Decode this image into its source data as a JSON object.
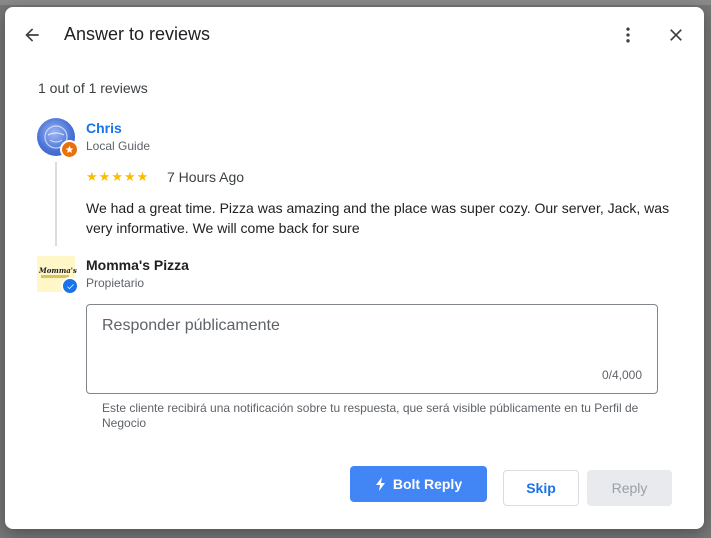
{
  "header": {
    "title": "Answer to reviews"
  },
  "review_count": "1 out of 1 reviews",
  "review": {
    "author": "Chris",
    "author_subtitle": "Local Guide",
    "rating": 5,
    "stars": [
      "★",
      "★",
      "★",
      "★",
      "★"
    ],
    "time": "7 Hours Ago",
    "text": "We had a great time. Pizza was amazing and the place was super cozy. Our server, Jack, was very informative. We will come back for sure"
  },
  "business": {
    "name": "Momma's Pizza",
    "role": "Propietario",
    "logo_text": "Momma's"
  },
  "reply_field": {
    "placeholder": "Responder públicamente",
    "counter": "0/4,000"
  },
  "helper_text": "Este cliente recibirá una notificación sobre tu respuesta, que será visible públicamente en tu Perfil de Negocio",
  "buttons": {
    "bolt_reply": "Bolt Reply",
    "skip": "Skip",
    "reply": "Reply"
  },
  "colors": {
    "accent": "#1a73e8",
    "bolt_button": "#4285f4",
    "star": "#fbbc04",
    "local_guide_badge": "#e8710a"
  },
  "icons": {
    "back": "arrow-left",
    "more": "more-vertical",
    "close": "close",
    "bolt": "lightning-bolt"
  }
}
